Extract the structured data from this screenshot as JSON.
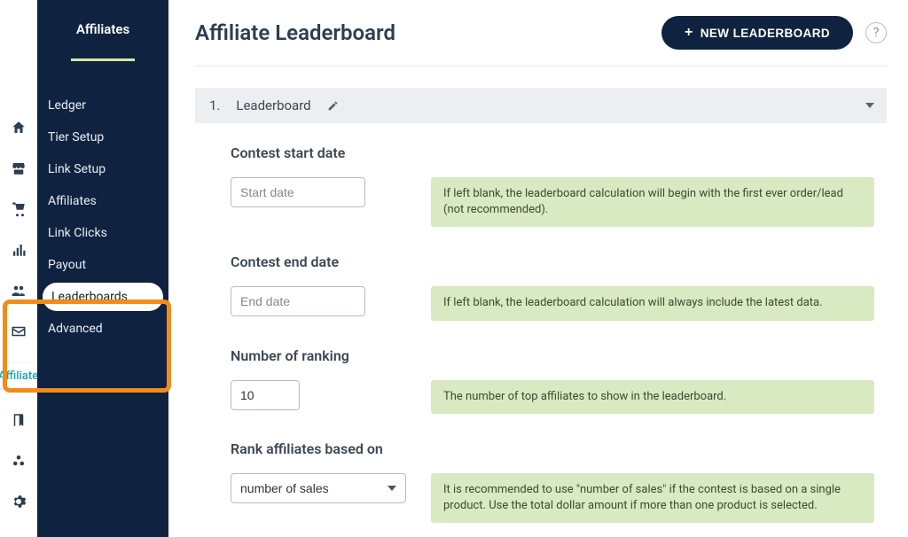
{
  "icon_rail": {
    "pill_label": "Affiliates"
  },
  "sidebar": {
    "title": "Affiliates",
    "items": [
      {
        "label": "Ledger",
        "active": false
      },
      {
        "label": "Tier Setup",
        "active": false
      },
      {
        "label": "Link Setup",
        "active": false
      },
      {
        "label": "Affiliates",
        "active": false
      },
      {
        "label": "Link Clicks",
        "active": false
      },
      {
        "label": "Payout",
        "active": false
      },
      {
        "label": "Leaderboards",
        "active": true
      },
      {
        "label": "Advanced",
        "active": false
      }
    ]
  },
  "header": {
    "title": "Affiliate Leaderboard",
    "new_button": "NEW LEADERBOARD"
  },
  "accordion": {
    "index": "1.",
    "name": "Leaderboard"
  },
  "form": {
    "start_date_label": "Contest start date",
    "start_date_placeholder": "Start date",
    "start_date_info": "If left blank, the leaderboard calculation will begin with the first ever order/lead (not recommended).",
    "end_date_label": "Contest end date",
    "end_date_placeholder": "End date",
    "end_date_info": "If left blank, the leaderboard calculation will always include the latest data.",
    "ranking_label": "Number of ranking",
    "ranking_value": "10",
    "ranking_info": "The number of top affiliates to show in the leaderboard.",
    "rank_basis_label": "Rank affiliates based on",
    "rank_basis_value": "number of sales",
    "rank_basis_info": "It is recommended to use \"number of sales\" if the contest is based on a single product. Use the total dollar amount if more than one product is selected."
  }
}
